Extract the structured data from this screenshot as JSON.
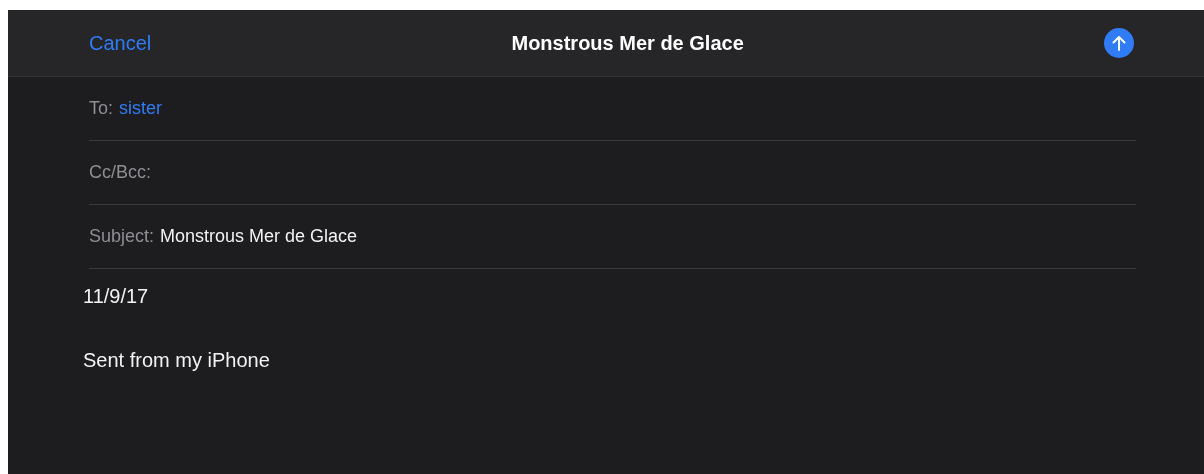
{
  "header": {
    "cancel": "Cancel",
    "title": "Monstrous Mer de Glace"
  },
  "fields": [
    {
      "label": "To:",
      "value": "sister",
      "kind": "recipient"
    },
    {
      "label": "Cc/Bcc:",
      "kind": "empty"
    },
    {
      "label": "Subject:",
      "value": "Monstrous Mer de Glace",
      "kind": "text"
    }
  ],
  "body": [
    "11/9/17",
    "Sent from my iPhone"
  ]
}
